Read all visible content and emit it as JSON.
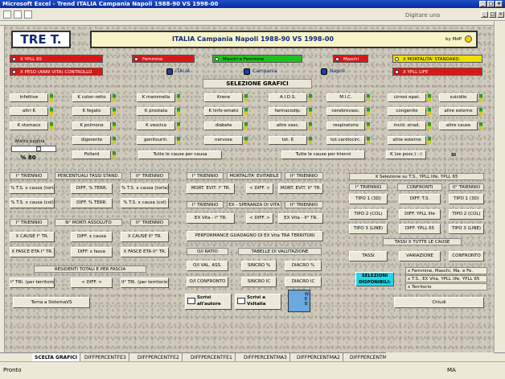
{
  "app": {
    "title": "Microsoft Excel - Trend ITALIA Campania Napoli 1988-90 VS 1998-00",
    "ask": "Digitare una domanda."
  },
  "logo": "TRE T.",
  "header": {
    "title": "ITALIA Campania Napoli 1988-90 VS 1998-00",
    "by": "by MdP"
  },
  "checks": {
    "ylg": "X YPLL 65",
    "female": "Femmine",
    "mf": "Maschi e Femmine",
    "male": "Maschi",
    "mort": "X MORTALITA' STANDARD.",
    "peso": "X PESO (ANNI VITA) CONTROLLO",
    "ypllc": "X YPLL LIFE"
  },
  "places": {
    "italia": "ITALIA",
    "campania": "Campania",
    "napoli": "Napoli"
  },
  "sel": "SELEZIONE GRAFICI",
  "grid": {
    "c1": [
      "Infettive",
      "altri K",
      "K stomaco"
    ],
    "c2": [
      "K colon-retto",
      "K fegato",
      "K polmone",
      "digerente",
      "Pollard"
    ],
    "c3": [
      "K mammella",
      "K prostata",
      "K vescica",
      "genitourin."
    ],
    "c4": [
      "Krene",
      "K linfo-emato",
      "diabete",
      "nervose"
    ],
    "c5": [
      "A.I.D.S.",
      "farmacodip.",
      "altre vasc.",
      "tot. K"
    ],
    "c6": [
      "M.I.C.",
      "cerebrovasc.",
      "respiratorie",
      "tot.cardiocirc."
    ],
    "c7": [
      "cirrosi epat.",
      "congenite",
      "incid. strad.",
      "altre esterne"
    ],
    "c8": [
      "suicidio",
      "altre esterne",
      "altre cause"
    ],
    "tutte1": "Tutte le cause per causa",
    "tutte2": "Tutte le cause per trienni",
    "kse": "K (se poss.) :-)",
    "si": "SI",
    "atatta": "Atatta pagina",
    "pct": "% 80"
  },
  "p1": {
    "h1": "I° TRIENNIO",
    "h2": "PERCENTUALI TASSI STAND.",
    "h3": "II° TRIENNIO",
    "b": [
      "% T.S. x causa (torta)",
      "DIFF, % TERR.",
      "% T.S. x causa (torta)",
      "% T.S. x causa (col)",
      "DIFF. % TERR.",
      "% T.S. x causa (col)"
    ]
  },
  "p2": {
    "h1": "I° TRIENNIO",
    "h2": "N° MORTI ASSOLUTO",
    "h3": "II° TRIENNIO",
    "b": [
      "X CAUSE I° TR.",
      "DIFF. x causa",
      "X CAUSE II° TR.",
      "X FASCE ETA I° TR.",
      "DIFF. x fasce",
      "X FASCE ETA II° TR."
    ]
  },
  "p3": {
    "h": "RESIDENTI TOTALI E PER FASCIA",
    "b": [
      "I° TRI. (per territorio)",
      "< DIFF. >",
      "II° TRI. (per territorio)"
    ]
  },
  "m1": {
    "h1": "I° TRIENNIO",
    "h2": "MORTALITA' EVITABILE",
    "h3": "II° TRIENNIO",
    "b": [
      "MORT. EVIT. I° TR.",
      "< DIFF. >",
      "MORT. EVIT. II° TR."
    ]
  },
  "m2": {
    "h1": "I° TRIENNIO",
    "h2": "EX - SPERANZA DI VITA",
    "h3": "II° TRIENNIO",
    "b": [
      "EX Vita - I° TR.",
      "< DIFF. >",
      "EX Vita - II° TR."
    ]
  },
  "perf": "PERFORMANCE GUADAGNO DI EX Vita TRA TERRITORI",
  "oxi": {
    "h": "O/I RATIO",
    "b": [
      "O/I VAL. ASS.",
      "O/I CONFRONTO"
    ]
  },
  "tv": {
    "h": "TABELLE DI VALUTAZIONE",
    "b": [
      "SINCRO %",
      "DIACRO %",
      "SINCRO IC",
      "DIACRO IC"
    ]
  },
  "r": {
    "h": "X Selezione su T.S., YPLL life, YPLL 65",
    "h1": "I° TRIENNIO",
    "h2": "CONFRONTI",
    "h3": "II° TRIENNIO",
    "b": [
      "TIPO 1 (3D)",
      "DIFF. T.S.",
      "TIPO 1 (3D)",
      "TIPO 2 (COL)",
      "DIFF. YPLL life",
      "TIPO 2 (COL)",
      "TIPO 3 (LINE)",
      "DIFF. YPLL 65",
      "TIPO 3 (LINE)"
    ]
  },
  "tassi": {
    "h": "TASSI X TUTTE LE CAUSE",
    "b": [
      "TASSI",
      "VARIAZIONE",
      "CONFRONTO"
    ]
  },
  "selez": "SELEZIONI DISPONIBILI:",
  "selezlist": [
    "x Femmine, Maschi, Ma. e Fe.",
    "x T.S., EX Vita, YPLL life, YPLL 65",
    "x Territorio"
  ],
  "foot": {
    "torna": "Torna a SistemaVS",
    "scrivi1": "Scrivi all'autore",
    "scrivi2": "Scrivi a VsItalia",
    "web": "WEB",
    "chiudi": "Chiudi"
  },
  "tabs": [
    "SCELTA GRAFICI",
    "DIFFPERCENTFE3",
    "DIFFPERCENTFE2",
    "DIFFPERCENTFE1",
    "DIFFPERCENTMA3",
    "DIFFPERCENTMA2",
    "DIFFPERCENTMA1",
    "DIFFPERCENTM"
  ],
  "status": {
    "left": "Pronto",
    "right": "MA"
  }
}
